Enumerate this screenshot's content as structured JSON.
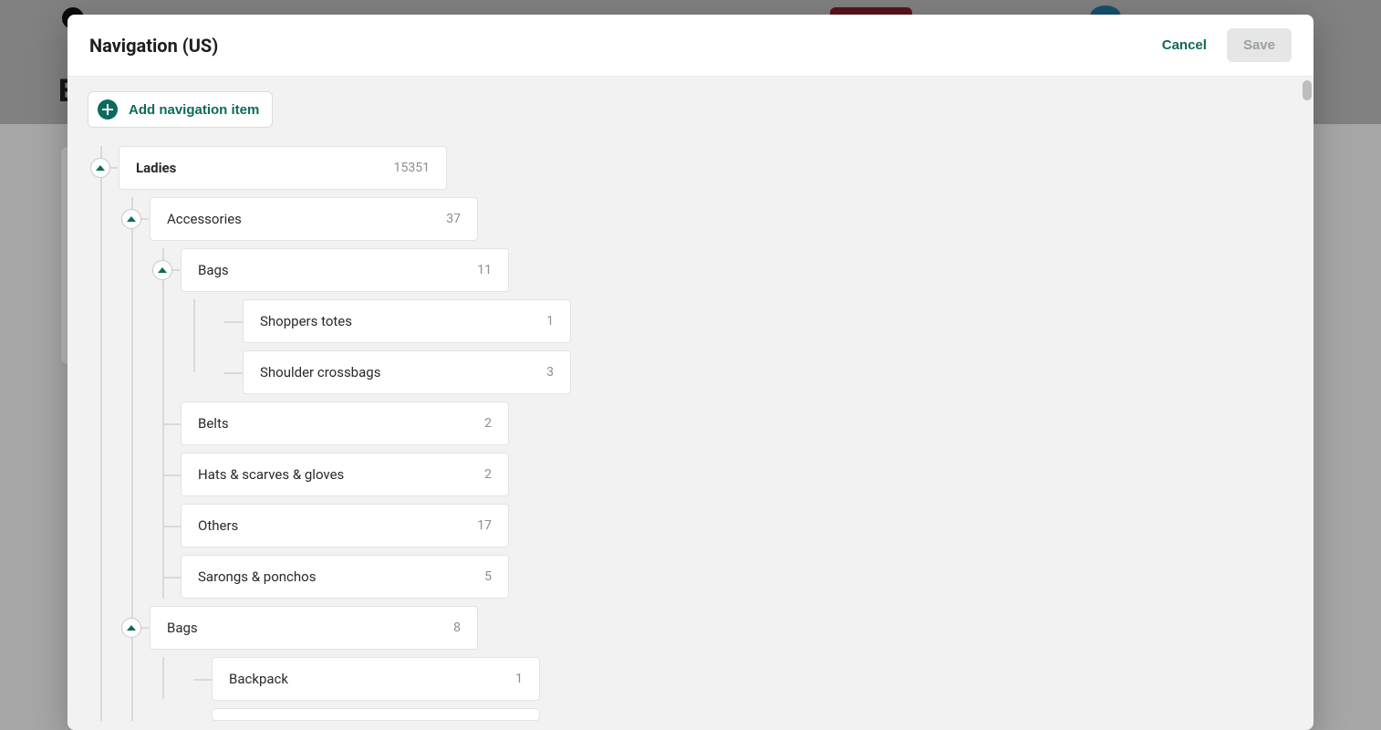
{
  "modal": {
    "title": "Navigation (US)",
    "cancel": "Cancel",
    "save": "Save",
    "add": "Add navigation item"
  },
  "tree": {
    "root": {
      "label": "Ladies",
      "count": "15351"
    },
    "accessories": {
      "label": "Accessories",
      "count": "37"
    },
    "bags_inner": {
      "label": "Bags",
      "count": "11"
    },
    "shoppers": {
      "label": "Shoppers totes",
      "count": "1"
    },
    "shoulder": {
      "label": "Shoulder crossbags",
      "count": "3"
    },
    "belts": {
      "label": "Belts",
      "count": "2"
    },
    "hats": {
      "label": "Hats & scarves & gloves",
      "count": "2"
    },
    "others": {
      "label": "Others",
      "count": "17"
    },
    "sarongs": {
      "label": "Sarongs & ponchos",
      "count": "5"
    },
    "bags_outer": {
      "label": "Bags",
      "count": "8"
    },
    "backpack": {
      "label": "Backpack",
      "count": "1"
    }
  }
}
